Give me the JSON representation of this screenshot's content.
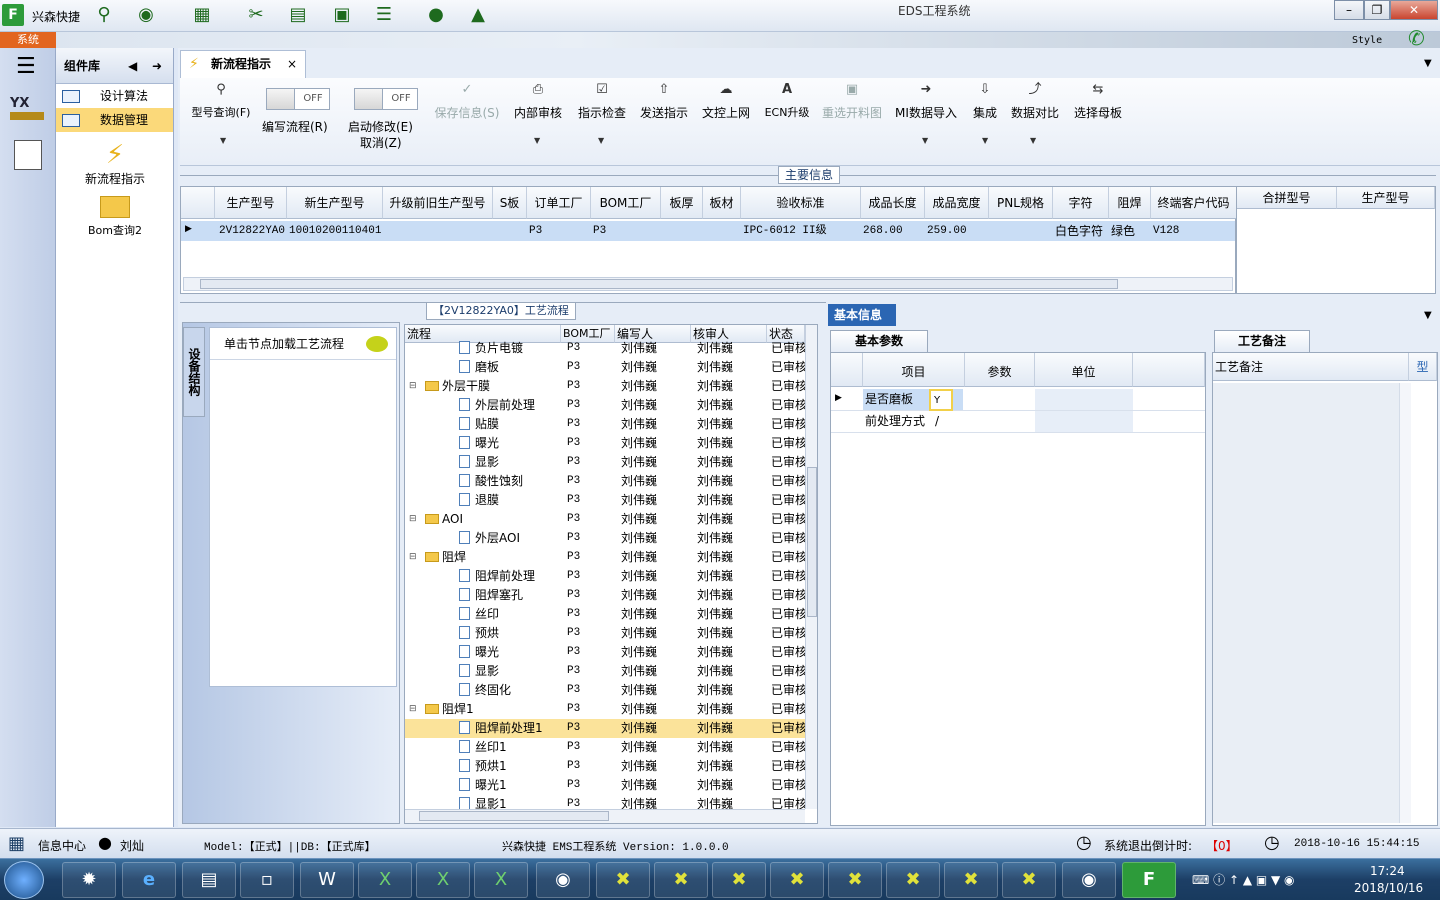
{
  "app": {
    "title": "EDS工程系统",
    "brand": "兴森快捷",
    "style_label": "Style"
  },
  "ribbon": {
    "sys_tab": "系统"
  },
  "nav": {
    "component_lib": "组件库",
    "items": [
      {
        "label": "设计算法"
      },
      {
        "label": "数据管理"
      }
    ],
    "tools": [
      {
        "label": "新流程指示"
      },
      {
        "label": "Bom查询2"
      }
    ]
  },
  "doc_tab": {
    "label": "新流程指示",
    "close": "×"
  },
  "toolbar": {
    "items": [
      {
        "label": "型号查询(F)",
        "icon": "search-icon"
      },
      {
        "label": "编写流程(R)",
        "toggle": "OFF"
      },
      {
        "label": "启动修改(E)",
        "sub": "取消(Z)",
        "toggle": "OFF"
      },
      {
        "label": "保存信息(S)",
        "icon": "check-icon"
      },
      {
        "label": "内部审核",
        "icon": "print-icon"
      },
      {
        "label": "指示检查",
        "icon": "checkbox-icon"
      },
      {
        "label": "发送指示",
        "icon": "upload-icon"
      },
      {
        "label": "文控上网",
        "icon": "cloud-upload-icon"
      },
      {
        "label": "ECN升级",
        "icon": "font-a-icon"
      },
      {
        "label": "重选开料图",
        "icon": "image-icon"
      },
      {
        "label": "MI数据导入",
        "icon": "import-icon"
      },
      {
        "label": "集成",
        "icon": "download-icon"
      },
      {
        "label": "数据对比",
        "icon": "compare-icon"
      },
      {
        "label": "选择母板",
        "icon": "shuffle-icon"
      }
    ]
  },
  "main_info": {
    "title": "主要信息",
    "columns": [
      "生产型号",
      "新生产型号",
      "升级前旧生产型号",
      "S板",
      "订单工厂",
      "BOM工厂",
      "板厚",
      "板材",
      "验收标准",
      "成品长度",
      "成品宽度",
      "PNL规格",
      "字符",
      "阻焊",
      "终端客户代码"
    ],
    "row": [
      "2V12822YA0",
      "10010200110401",
      "",
      "",
      "P3",
      "P3",
      "",
      "",
      "IPC-6012 II级",
      "268.00",
      "259.00",
      "",
      "白色字符",
      "绿色",
      "V128"
    ],
    "side_columns": [
      "合拼型号",
      "生产型号"
    ]
  },
  "process": {
    "title": "【2V12822YA0】工艺流程",
    "vertical_tab": "设备结构",
    "hint": "单击节点加载工艺流程",
    "columns": [
      "流程",
      "BOM工厂",
      "编写人",
      "核审人",
      "状态"
    ],
    "rows": [
      {
        "name": "负片电镀",
        "factory": "P3",
        "writer": "刘伟巍",
        "reviewer": "刘伟巍",
        "status": "已审核",
        "level": 2,
        "folder": false
      },
      {
        "name": "磨板",
        "factory": "P3",
        "writer": "刘伟巍",
        "reviewer": "刘伟巍",
        "status": "已审核",
        "level": 2,
        "folder": false
      },
      {
        "name": "外层干膜",
        "factory": "P3",
        "writer": "刘伟巍",
        "reviewer": "刘伟巍",
        "status": "已审核",
        "level": 1,
        "folder": true
      },
      {
        "name": "外层前处理",
        "factory": "P3",
        "writer": "刘伟巍",
        "reviewer": "刘伟巍",
        "status": "已审核",
        "level": 2,
        "folder": false
      },
      {
        "name": "贴膜",
        "factory": "P3",
        "writer": "刘伟巍",
        "reviewer": "刘伟巍",
        "status": "已审核",
        "level": 2,
        "folder": false
      },
      {
        "name": "曝光",
        "factory": "P3",
        "writer": "刘伟巍",
        "reviewer": "刘伟巍",
        "status": "已审核",
        "level": 2,
        "folder": false
      },
      {
        "name": "显影",
        "factory": "P3",
        "writer": "刘伟巍",
        "reviewer": "刘伟巍",
        "status": "已审核",
        "level": 2,
        "folder": false
      },
      {
        "name": "酸性蚀刻",
        "factory": "P3",
        "writer": "刘伟巍",
        "reviewer": "刘伟巍",
        "status": "已审核",
        "level": 2,
        "folder": false
      },
      {
        "name": "退膜",
        "factory": "P3",
        "writer": "刘伟巍",
        "reviewer": "刘伟巍",
        "status": "已审核",
        "level": 2,
        "folder": false
      },
      {
        "name": "AOI",
        "factory": "P3",
        "writer": "刘伟巍",
        "reviewer": "刘伟巍",
        "status": "已审核",
        "level": 1,
        "folder": true
      },
      {
        "name": "外层AOI",
        "factory": "P3",
        "writer": "刘伟巍",
        "reviewer": "刘伟巍",
        "status": "已审核",
        "level": 2,
        "folder": false
      },
      {
        "name": "阻焊",
        "factory": "P3",
        "writer": "刘伟巍",
        "reviewer": "刘伟巍",
        "status": "已审核",
        "level": 1,
        "folder": true
      },
      {
        "name": "阻焊前处理",
        "factory": "P3",
        "writer": "刘伟巍",
        "reviewer": "刘伟巍",
        "status": "已审核",
        "level": 2,
        "folder": false
      },
      {
        "name": "阻焊塞孔",
        "factory": "P3",
        "writer": "刘伟巍",
        "reviewer": "刘伟巍",
        "status": "已审核",
        "level": 2,
        "folder": false
      },
      {
        "name": "丝印",
        "factory": "P3",
        "writer": "刘伟巍",
        "reviewer": "刘伟巍",
        "status": "已审核",
        "level": 2,
        "folder": false
      },
      {
        "name": "预烘",
        "factory": "P3",
        "writer": "刘伟巍",
        "reviewer": "刘伟巍",
        "status": "已审核",
        "level": 2,
        "folder": false
      },
      {
        "name": "曝光",
        "factory": "P3",
        "writer": "刘伟巍",
        "reviewer": "刘伟巍",
        "status": "已审核",
        "level": 2,
        "folder": false
      },
      {
        "name": "显影",
        "factory": "P3",
        "writer": "刘伟巍",
        "reviewer": "刘伟巍",
        "status": "已审核",
        "level": 2,
        "folder": false
      },
      {
        "name": "终固化",
        "factory": "P3",
        "writer": "刘伟巍",
        "reviewer": "刘伟巍",
        "status": "已审核",
        "level": 2,
        "folder": false
      },
      {
        "name": "阻焊1",
        "factory": "P3",
        "writer": "刘伟巍",
        "reviewer": "刘伟巍",
        "status": "已审核",
        "level": 1,
        "folder": true
      },
      {
        "name": "阻焊前处理1",
        "factory": "P3",
        "writer": "刘伟巍",
        "reviewer": "刘伟巍",
        "status": "已审核",
        "level": 2,
        "folder": false,
        "selected": true
      },
      {
        "name": "丝印1",
        "factory": "P3",
        "writer": "刘伟巍",
        "reviewer": "刘伟巍",
        "status": "已审核",
        "level": 2,
        "folder": false
      },
      {
        "name": "预烘1",
        "factory": "P3",
        "writer": "刘伟巍",
        "reviewer": "刘伟巍",
        "status": "已审核",
        "level": 2,
        "folder": false
      },
      {
        "name": "曝光1",
        "factory": "P3",
        "writer": "刘伟巍",
        "reviewer": "刘伟巍",
        "status": "已审核",
        "level": 2,
        "folder": false
      },
      {
        "name": "显影1",
        "factory": "P3",
        "writer": "刘伟巍",
        "reviewer": "刘伟巍",
        "status": "已审核",
        "level": 2,
        "folder": false
      }
    ]
  },
  "basic_info": {
    "title": "基本信息",
    "tab": "基本参数",
    "columns": [
      "项目",
      "参数",
      "单位"
    ],
    "rows": [
      {
        "item": "是否磨板",
        "param": "Y",
        "unit": ""
      },
      {
        "item": "前处理方式",
        "param": "/",
        "unit": ""
      }
    ]
  },
  "craft_note": {
    "tab": "工艺备注",
    "column": "工艺备注",
    "column2": "型"
  },
  "status_bar": {
    "info_center": "信息中心",
    "user": "刘灿",
    "model": "Model:【正式】||DB:【正式库】",
    "version": "兴森快捷 EMS工程系统 Version: 1.0.0.0",
    "countdown_label": "系统退出倒计时:",
    "countdown_value": "【0】",
    "datetime": "2018-10-16 15:44:15"
  },
  "taskbar": {
    "time": "17:24",
    "date": "2018/10/16"
  }
}
